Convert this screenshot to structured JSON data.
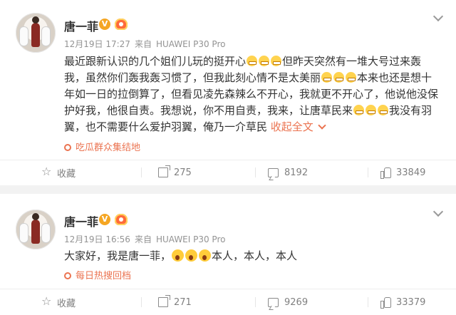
{
  "colors": {
    "accent": "#eb7350",
    "meta_gray": "#939393",
    "page_bg": "#f2f2f2",
    "vip_badge": "#f5a623"
  },
  "posts": [
    {
      "author": "唐一菲",
      "verified_badge": "V",
      "level_icon": "user-level-icon",
      "date": "12月19日 17:27",
      "via_prefix": "来自",
      "device": "HUAWEI P30 Pro",
      "content_parts": [
        "最近跟新认识的几个姐们儿玩的挺开心",
        "但昨天突然有一堆大号过来轰我，虽然你们轰我轰习惯了，但我此刻心情不是太美丽",
        "本来也还是想十年如一日的拉倒算了，但看见凌先森辣么不开心，我就更不开心了，他说他没保护好我，他很自责。我想说，你不用自责，我来，让唐草民来",
        "我没有羽翼，也不需要什么爱护羽翼，俺乃一介草民 "
      ],
      "expand_label": "收起全文",
      "source_label": "吃瓜群众集结地",
      "actions": {
        "favorite": "收藏",
        "reposts": "275",
        "comments": "8192",
        "likes": "33849"
      }
    },
    {
      "author": "唐一菲",
      "verified_badge": "V",
      "level_icon": "user-level-icon",
      "date": "12月19日 16:56",
      "via_prefix": "来自",
      "device": "HUAWEI P30 Pro",
      "content_parts": [
        "大家好，我是唐一菲，",
        "本人，本人，本人"
      ],
      "source_label": "每日热搜回档",
      "actions": {
        "favorite": "收藏",
        "reposts": "271",
        "comments": "9269",
        "likes": "33379"
      }
    }
  ]
}
